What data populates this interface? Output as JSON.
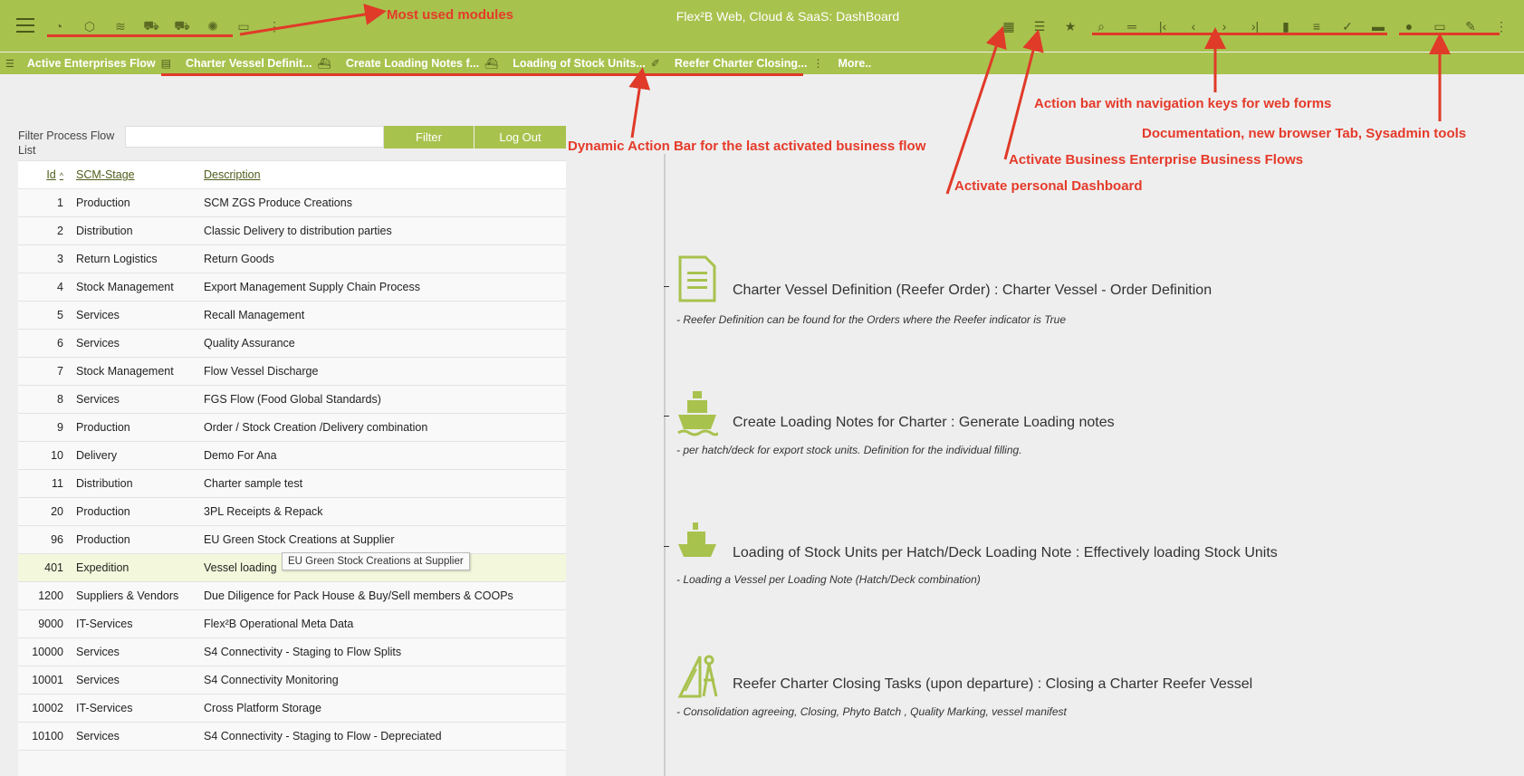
{
  "app": {
    "title": "Flex²B Web, Cloud & SaaS: DashBoard"
  },
  "module_icons": [
    "chart-icon",
    "box-icon",
    "layers-icon",
    "truck-icon",
    "truck-loaded-icon",
    "network-icon",
    "folder-icon",
    "more-vertical-icon"
  ],
  "action_bar_icons": [
    {
      "name": "calendar-icon",
      "glyph": "▦"
    },
    {
      "name": "list-icon",
      "glyph": "☰"
    },
    {
      "name": "star-icon",
      "glyph": "★"
    },
    {
      "name": "search-icon",
      "glyph": "⌕"
    },
    {
      "name": "equals-icon",
      "glyph": "═"
    },
    {
      "name": "first-record-icon",
      "glyph": "|‹"
    },
    {
      "name": "previous-record-icon",
      "glyph": "‹"
    },
    {
      "name": "next-record-icon",
      "glyph": "›"
    },
    {
      "name": "last-record-icon",
      "glyph": "›|"
    },
    {
      "name": "new-document-icon",
      "glyph": "▮"
    },
    {
      "name": "edit-icon",
      "glyph": "≡"
    },
    {
      "name": "check-icon",
      "glyph": "✓"
    },
    {
      "name": "delete-icon",
      "glyph": "▬"
    },
    {
      "name": "info-icon",
      "glyph": "●"
    },
    {
      "name": "folder-open-icon",
      "glyph": "▭"
    },
    {
      "name": "wrench-icon",
      "glyph": "✎"
    },
    {
      "name": "more-vertical-icon",
      "glyph": "⋮"
    }
  ],
  "flow_bar": {
    "tabs": [
      {
        "label": "Active Enterprises Flow",
        "icon": "document-icon",
        "glyph": "▤"
      },
      {
        "label": "Charter Vessel Definit...",
        "icon": "ship-icon",
        "glyph": "⛴"
      },
      {
        "label": "Create Loading Notes f...",
        "icon": "ship-loaded-icon",
        "glyph": "⛴"
      },
      {
        "label": "Loading of Stock Units...",
        "icon": "tools-icon",
        "glyph": "✐"
      },
      {
        "label": "Reefer Charter Closing...",
        "icon": "more-vertical-icon",
        "glyph": "⋮"
      }
    ],
    "more_label": "More.."
  },
  "annotations": {
    "most_used": "Most used modules",
    "dynamic_bar": "Dynamic Action Bar for the last activated business flow",
    "action_bar": "Action bar with navigation keys for web forms",
    "documentation": "Documentation, new browser Tab, Sysadmin tools",
    "business_flows": "Activate Business Enterprise Business Flows",
    "personal_dashboard": "Activate personal Dashboard"
  },
  "filter": {
    "label": "Filter Process Flow List",
    "value": "",
    "filter_button": "Filter",
    "logout_button": "Log Out"
  },
  "table": {
    "headers": {
      "id": "Id",
      "stage": "SCM-Stage",
      "description": "Description"
    },
    "rows": [
      {
        "id": "1",
        "stage": "Production",
        "description": "SCM ZGS Produce Creations"
      },
      {
        "id": "2",
        "stage": "Distribution",
        "description": "Classic Delivery to distribution parties"
      },
      {
        "id": "3",
        "stage": "Return Logistics",
        "description": "Return Goods"
      },
      {
        "id": "4",
        "stage": "Stock Management",
        "description": "Export Management Supply Chain Process"
      },
      {
        "id": "5",
        "stage": "Services",
        "description": "Recall Management"
      },
      {
        "id": "6",
        "stage": "Services",
        "description": "Quality Assurance"
      },
      {
        "id": "7",
        "stage": "Stock Management",
        "description": "Flow Vessel Discharge"
      },
      {
        "id": "8",
        "stage": "Services",
        "description": "FGS Flow (Food Global Standards)"
      },
      {
        "id": "9",
        "stage": "Production",
        "description": "Order / Stock Creation /Delivery combination"
      },
      {
        "id": "10",
        "stage": "Delivery",
        "description": "Demo For Ana"
      },
      {
        "id": "11",
        "stage": "Distribution",
        "description": "Charter sample test"
      },
      {
        "id": "20",
        "stage": "Production",
        "description": "3PL Receipts & Repack"
      },
      {
        "id": "96",
        "stage": "Production",
        "description": "EU Green Stock Creations at Supplier"
      },
      {
        "id": "401",
        "stage": "Expedition",
        "description": "Vessel loading"
      },
      {
        "id": "1200",
        "stage": "Suppliers & Vendors",
        "description": "Due Diligence for Pack House & Buy/Sell members & COOPs"
      },
      {
        "id": "9000",
        "stage": "IT-Services",
        "description": "Flex²B Operational Meta Data"
      },
      {
        "id": "10000",
        "stage": "Services",
        "description": "S4 Connectivity - Staging to Flow Splits"
      },
      {
        "id": "10001",
        "stage": "Services",
        "description": "S4 Connectivity Monitoring"
      },
      {
        "id": "10002",
        "stage": "IT-Services",
        "description": "Cross Platform Storage"
      },
      {
        "id": "10100",
        "stage": "Services",
        "description": "S4 Connectivity - Staging to Flow - Depreciated"
      }
    ],
    "tooltip": "EU Green Stock Creations at Supplier"
  },
  "flows": [
    {
      "title": "Charter Vessel Definition (Reefer Order) : Charter Vessel - Order Definition",
      "description": "- Reefer Definition can be found for the Orders where the Reefer indicator is True",
      "icon": "document-icon"
    },
    {
      "title": "Create Loading Notes for Charter : Generate Loading notes",
      "description": "- per hatch/deck for export stock units. Definition for the individual filling.",
      "icon": "ship-icon"
    },
    {
      "title": "Loading of Stock Units per Hatch/Deck Loading Note : Effectively loading Stock Units",
      "description": "- Loading a Vessel per Loading Note (Hatch/Deck combination)",
      "icon": "ship-loaded-icon"
    },
    {
      "title": "Reefer Charter Closing Tasks (upon departure) : Closing a Charter Reefer Vessel",
      "description": "- Consolidation agreeing, Closing, Phyto Batch , Quality Marking, vessel manifest",
      "icon": "drafting-tools-icon"
    }
  ],
  "colors": {
    "brand": "#a8c24e",
    "annotation": "#e53a2a",
    "icon_dark": "#4f5e1c"
  }
}
